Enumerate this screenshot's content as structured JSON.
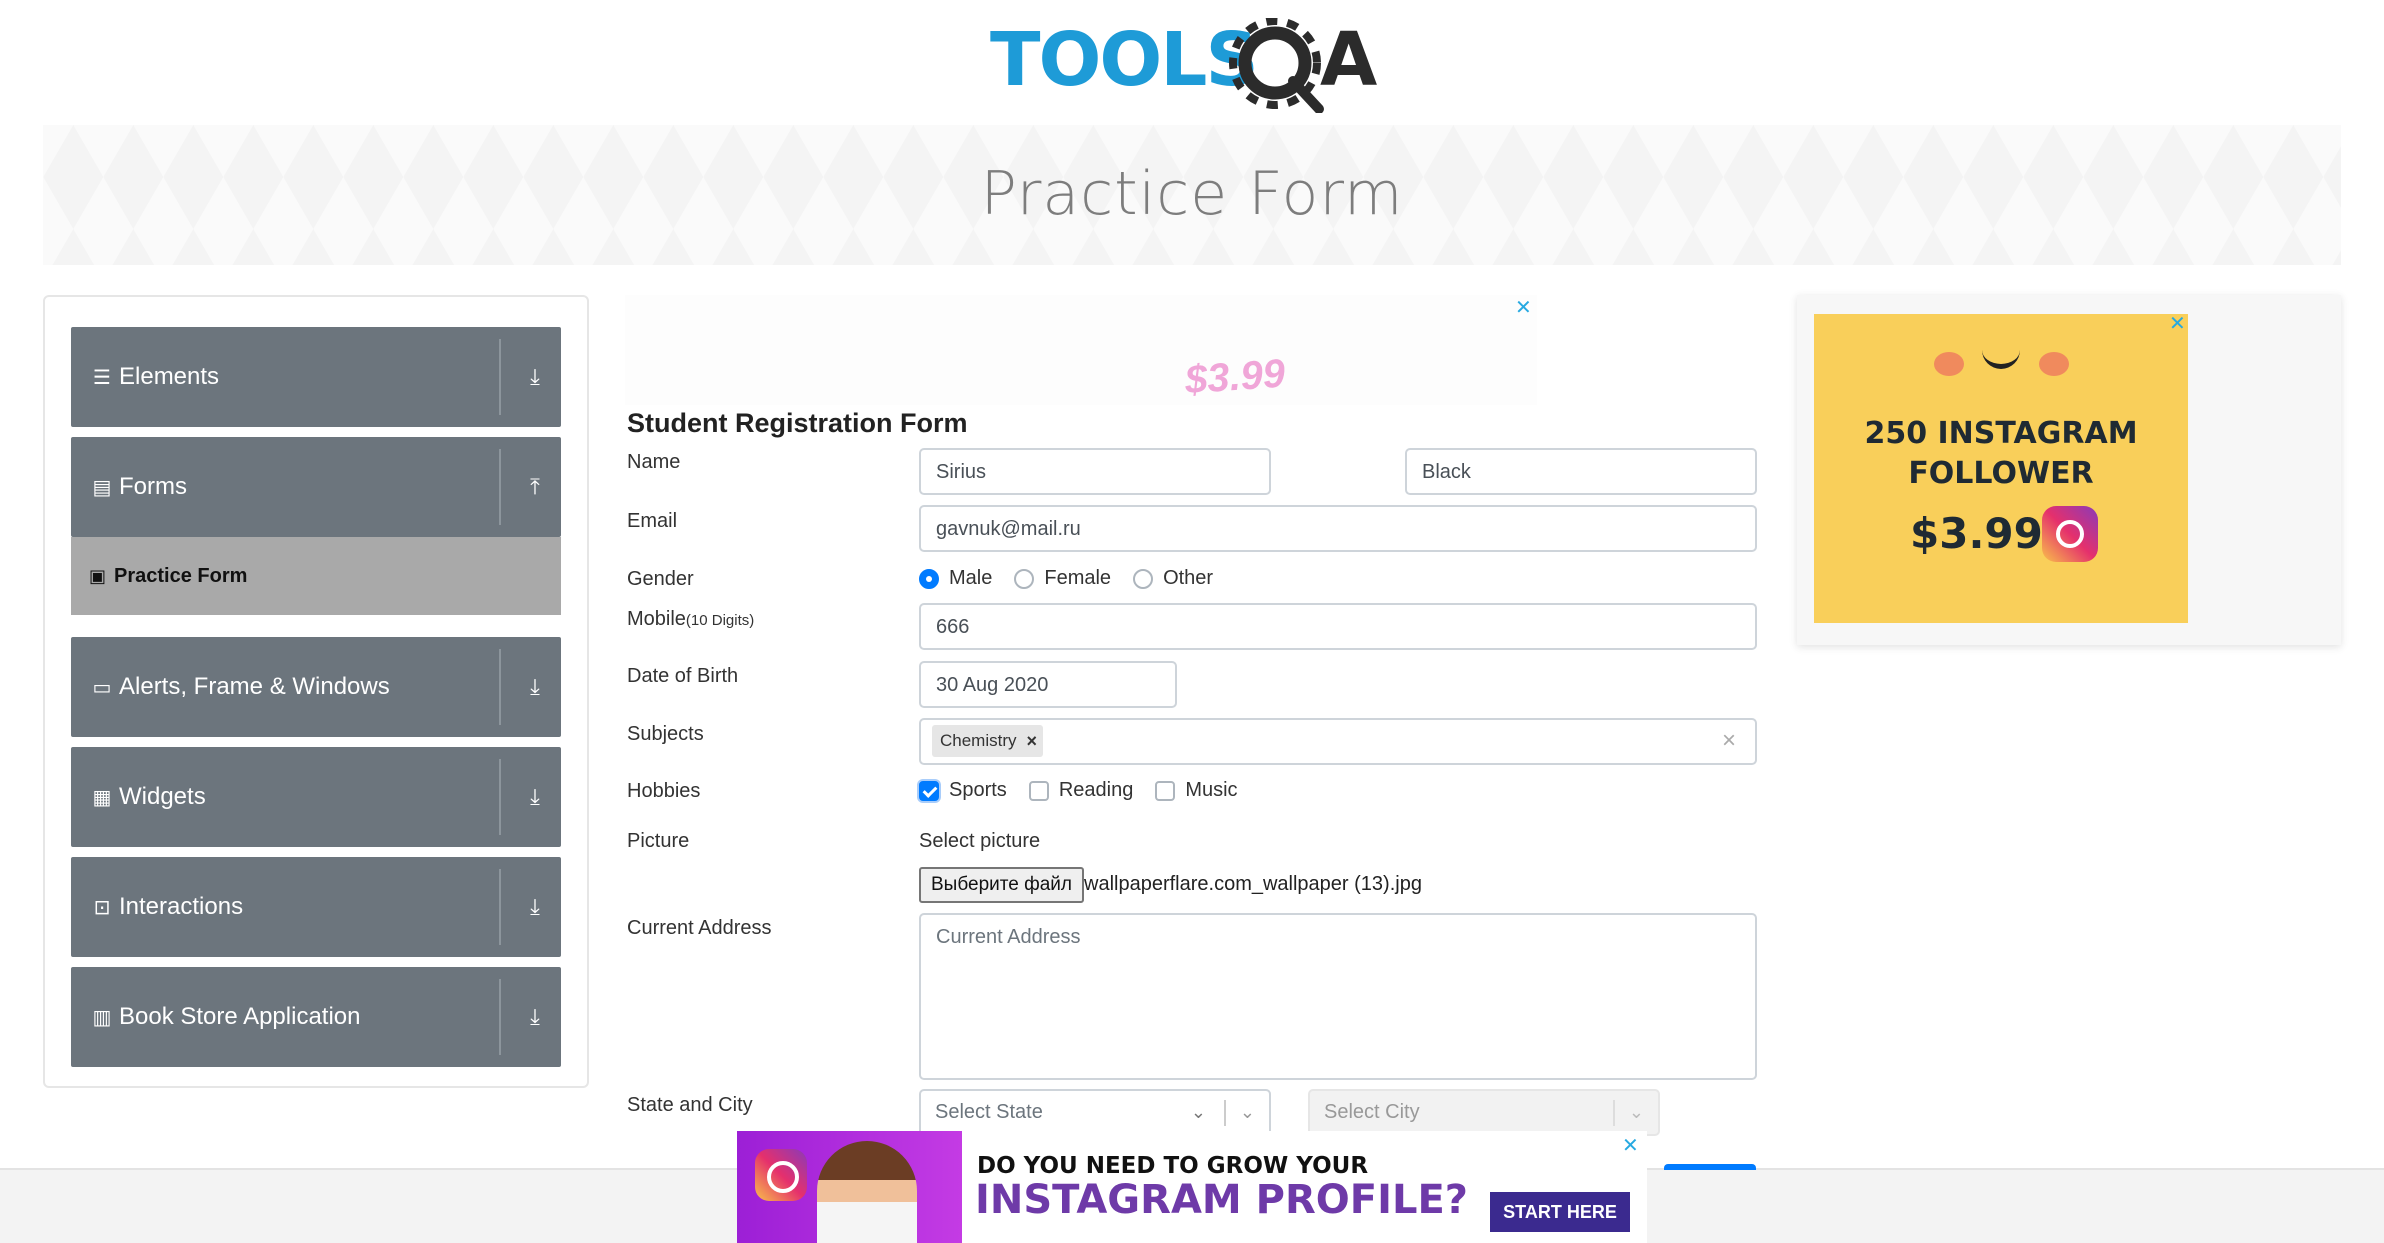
{
  "header": {
    "logo_text": "TOOLSQA"
  },
  "banner": {
    "title": "Practice Form"
  },
  "sidebar": {
    "groups": [
      {
        "label": "Elements",
        "icon": "menu-icon",
        "arrow": "download-arrow"
      },
      {
        "label": "Forms",
        "icon": "document-icon",
        "arrow": "upload-arrow"
      },
      {
        "label": "Alerts, Frame & Windows",
        "icon": "window-icon",
        "arrow": "download-arrow"
      },
      {
        "label": "Widgets",
        "icon": "widgets-icon",
        "arrow": "download-arrow"
      },
      {
        "label": "Interactions",
        "icon": "interactions-icon",
        "arrow": "download-arrow"
      },
      {
        "label": "Book Store Application",
        "icon": "books-icon",
        "arrow": "download-arrow"
      }
    ],
    "active_item": {
      "label": "Practice Form",
      "icon": "form-icon"
    }
  },
  "ads": {
    "top_price": "$3.99",
    "right_line1": "250 INSTAGRAM",
    "right_line2": "FOLLOWER",
    "right_price": "$3.99",
    "bottom_line1": "DO YOU NEED TO GROW YOUR",
    "bottom_line2": "INSTAGRAM PROFILE?",
    "bottom_cta": "START HERE",
    "close_glyph": "✕"
  },
  "form": {
    "title": "Student Registration Form",
    "name_label": "Name",
    "first_name": "Sirius",
    "last_name": "Black",
    "email_label": "Email",
    "email": "gavnuk@mail.ru",
    "gender_label": "Gender",
    "gender_options": [
      "Male",
      "Female",
      "Other"
    ],
    "gender_selected": "Male",
    "mobile_label": "Mobile",
    "mobile_hint": "(10 Digits)",
    "mobile": "666",
    "dob_label": "Date of Birth",
    "dob": "30 Aug 2020",
    "subjects_label": "Subjects",
    "subjects": [
      "Chemistry"
    ],
    "subject_remove": "×",
    "clear_all": "×",
    "hobbies_label": "Hobbies",
    "hobbies": [
      "Sports",
      "Reading",
      "Music"
    ],
    "hobbies_checked": [
      "Sports"
    ],
    "picture_label": "Picture",
    "select_picture": "Select picture",
    "file_button": "Выберите файл",
    "file_name": "wallpaperflare.com_wallpaper (13).jpg",
    "address_label": "Current Address",
    "address_placeholder": "Current Address",
    "state_city_label": "State and City",
    "state_placeholder": "Select State",
    "city_placeholder": "Select City"
  },
  "colors": {
    "sidebar_bg": "#6c757d",
    "active_bg": "#a9a9a9",
    "accent": "#007bff",
    "logo_blue": "#1e9bd7",
    "logo_dark": "#2b2b2b"
  }
}
